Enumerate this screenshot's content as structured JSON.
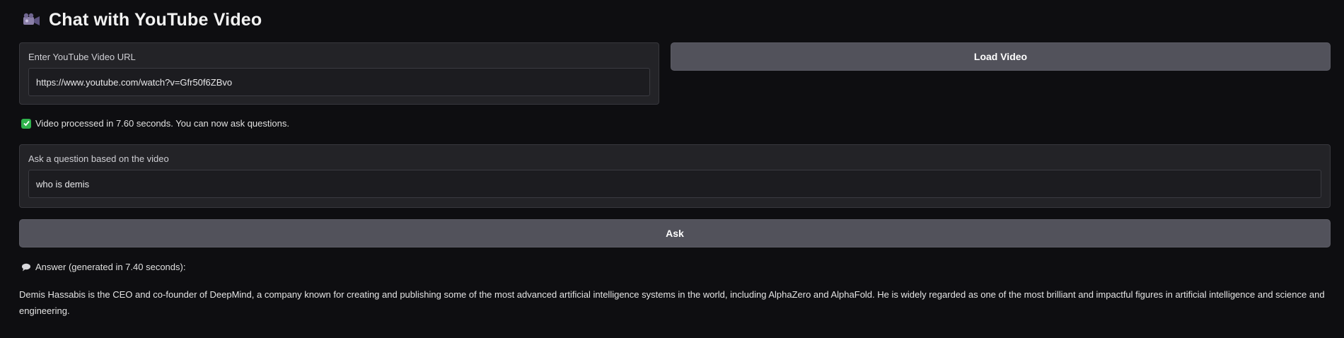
{
  "header": {
    "icon": "movie-camera-icon",
    "title": "Chat with YouTube Video"
  },
  "url_input": {
    "label": "Enter YouTube Video URL",
    "value": "https://www.youtube.com/watch?v=Gfr50f6ZBvo"
  },
  "load_button": {
    "label": "Load Video"
  },
  "status": {
    "icon": "check-mark-icon",
    "text": "Video processed in 7.60 seconds. You can now ask questions."
  },
  "question_input": {
    "label": "Ask a question based on the video",
    "value": "who is demis"
  },
  "ask_button": {
    "label": "Ask"
  },
  "answer": {
    "icon": "speech-balloon-icon",
    "heading": "Answer (generated in 7.40 seconds):",
    "text": "Demis Hassabis is the CEO and co-founder of DeepMind, a company known for creating and publishing some of the most advanced artificial intelligence systems in the world, including AlphaZero and AlphaFold. He is widely regarded as one of the most brilliant and impactful figures in artificial intelligence and science and engineering."
  },
  "colors": {
    "background": "#0e0e11",
    "panel": "#232327",
    "button": "#52525b",
    "check": "#2fb24c"
  }
}
